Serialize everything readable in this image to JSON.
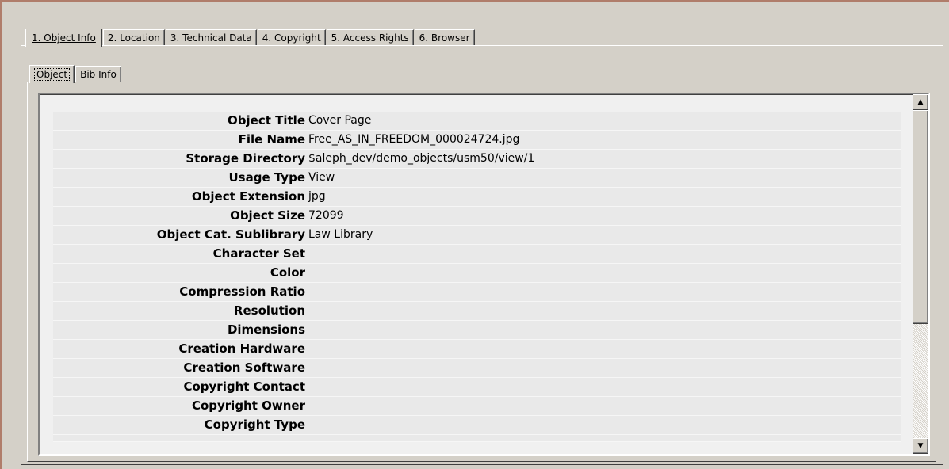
{
  "main_tabs": [
    {
      "label": "1. Object Info",
      "active": true
    },
    {
      "label": "2. Location",
      "active": false
    },
    {
      "label": "3. Technical Data",
      "active": false
    },
    {
      "label": "4. Copyright",
      "active": false
    },
    {
      "label": "5. Access Rights",
      "active": false
    },
    {
      "label": "6. Browser",
      "active": false
    }
  ],
  "sub_tabs": [
    {
      "label": "Object",
      "active": true
    },
    {
      "label": "Bib Info",
      "active": false
    }
  ],
  "fields": [
    {
      "label": "Object Title",
      "value": "Cover Page"
    },
    {
      "label": "File Name",
      "value": "Free_AS_IN_FREEDOM_000024724.jpg"
    },
    {
      "label": "Storage Directory",
      "value": "$aleph_dev/demo_objects/usm50/view/1"
    },
    {
      "label": "Usage Type",
      "value": "View"
    },
    {
      "label": "Object Extension",
      "value": "jpg"
    },
    {
      "label": "Object Size",
      "value": "72099"
    },
    {
      "label": "Object Cat. Sublibrary",
      "value": "Law Library"
    },
    {
      "label": "Character Set",
      "value": ""
    },
    {
      "label": "Color",
      "value": ""
    },
    {
      "label": "Compression Ratio",
      "value": ""
    },
    {
      "label": "Resolution",
      "value": ""
    },
    {
      "label": "Dimensions",
      "value": ""
    },
    {
      "label": "Creation Hardware",
      "value": ""
    },
    {
      "label": "Creation Software",
      "value": ""
    },
    {
      "label": "Copyright Contact",
      "value": ""
    },
    {
      "label": "Copyright Owner",
      "value": ""
    },
    {
      "label": "Copyright Type",
      "value": ""
    }
  ],
  "scrollbar": {
    "up_icon": "arrow-up-icon",
    "down_icon": "arrow-down-icon"
  },
  "colors": {
    "face": "#d4d0c8",
    "window_border": "#b07d6b"
  }
}
